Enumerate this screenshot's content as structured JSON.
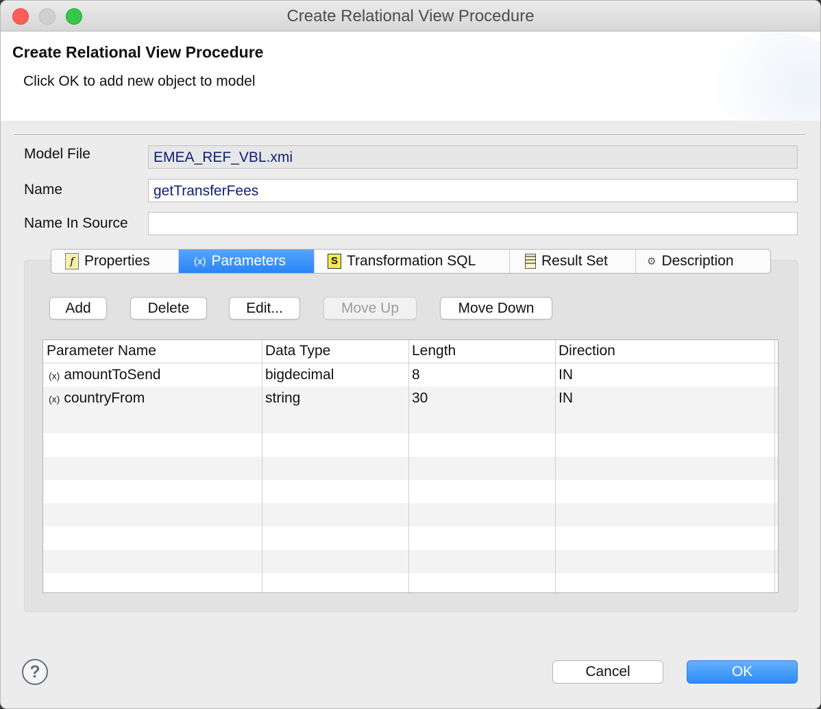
{
  "window": {
    "title": "Create Relational View Procedure"
  },
  "banner": {
    "heading": "Create Relational View Procedure",
    "message": "Click OK to add new object to model"
  },
  "form": {
    "model_file_label": "Model File",
    "model_file_value": "EMEA_REF_VBL.xmi",
    "name_label": "Name",
    "name_value": "getTransferFees",
    "name_in_source_label": "Name In Source",
    "name_in_source_value": ""
  },
  "tabs": [
    {
      "label": "Properties",
      "icon": "properties-icon"
    },
    {
      "label": "Parameters",
      "icon": "parameter-icon",
      "active": true
    },
    {
      "label": "Transformation SQL",
      "icon": "sql-icon"
    },
    {
      "label": "Result Set",
      "icon": "result-set-icon"
    },
    {
      "label": "Description",
      "icon": "description-icon"
    }
  ],
  "toolbar": {
    "add": "Add",
    "delete": "Delete",
    "edit": "Edit...",
    "move_up": "Move Up",
    "move_down": "Move Down"
  },
  "table": {
    "columns": [
      "Parameter Name",
      "Data Type",
      "Length",
      "Direction"
    ],
    "rows": [
      [
        "amountToSend",
        "bigdecimal",
        "8",
        "IN"
      ],
      [
        "countryFrom",
        "string",
        "30",
        "IN"
      ]
    ]
  },
  "footer": {
    "help": "?",
    "cancel": "Cancel",
    "ok": "OK"
  },
  "colors": {
    "accent": "#2a84f6",
    "field_text": "#0c1d77"
  }
}
